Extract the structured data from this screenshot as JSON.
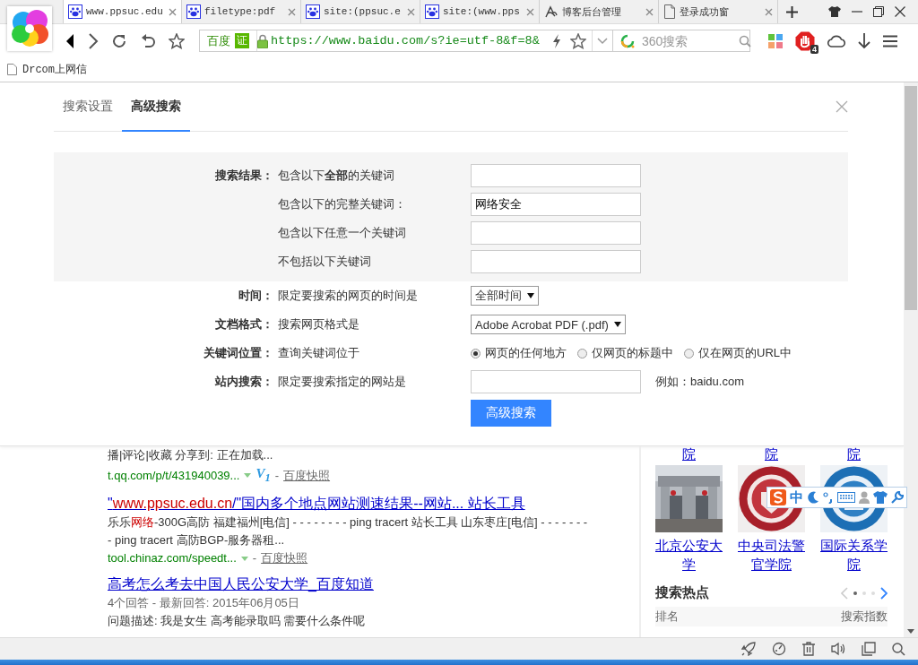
{
  "browser": {
    "tabs": [
      {
        "title": "www.ppsuc.edu",
        "kind": "paw",
        "selected": true
      },
      {
        "title": "filetype:pdf",
        "kind": "paw",
        "selected": false
      },
      {
        "title": "site:(ppsuc.e",
        "kind": "paw",
        "selected": false
      },
      {
        "title": "site:(www.pps",
        "kind": "paw",
        "selected": false
      },
      {
        "title": "博客后台管理",
        "kind": "blog",
        "selected": false
      },
      {
        "title": "登录成功窗",
        "kind": "page",
        "selected": false
      }
    ],
    "address_bar": {
      "site_name": "百度",
      "badge": "证",
      "url": "https://www.baidu.com/s?ie=utf-8&f=8&"
    },
    "search_box": {
      "placeholder": "360搜索"
    },
    "adblock_count": "4",
    "bookmarks": [
      "Drcom上网信"
    ]
  },
  "settings_panel": {
    "tabs": [
      {
        "label": "搜索设置",
        "selected": false
      },
      {
        "label": "高级搜索",
        "selected": true
      }
    ],
    "keyword_group": {
      "label": "搜索结果：",
      "rows": [
        {
          "description": "包含以下**全部**的关键词"
        },
        {
          "description": "包含以下的完整关键词：",
          "value": "网络安全"
        },
        {
          "description": "包含以下任意一个关键词"
        },
        {
          "description": "不包括以下关键词"
        }
      ]
    },
    "rows": [
      {
        "label": "时间：",
        "description": "限定要搜索的网页的时间是",
        "kind": "select",
        "value": "全部时间"
      },
      {
        "label": "文档格式：",
        "description": "搜索网页格式是",
        "kind": "select",
        "value": "Adobe Acrobat PDF (.pdf)"
      },
      {
        "label": "关键词位置：",
        "description": "查询关键词位于",
        "kind": "radio",
        "options": [
          {
            "label": "网页的任何地方",
            "selected": true
          },
          {
            "label": "仅网页的标题中",
            "selected": false
          },
          {
            "label": "仅在网页的URL中",
            "selected": false
          }
        ]
      },
      {
        "label": "站内搜索：",
        "description": "限定要搜索指定的网站是",
        "kind": "text",
        "hint": "例如：baidu.com"
      }
    ],
    "submit": "高级搜索"
  },
  "results": [
    {
      "snippet": [
        {
          "text": "播|评论|收藏 分享到: 正在加载...",
          "highlight": false
        }
      ],
      "url": "t.qq.com/p/t/431940039...",
      "badge": "V$_{1}$",
      "separator": "-",
      "snapshot": "百度快照"
    },
    {
      "title": [
        {
          "text": "\"",
          "highlight": false
        },
        {
          "text": "www.ppsuc.edu.cn",
          "highlight": true
        },
        {
          "text": "/\"国内多个地点网站测速结果--网站...  站长工具",
          "highlight": false
        }
      ],
      "snippet": [
        {
          "text": "乐乐",
          "highlight": false
        },
        {
          "text": "网络",
          "highlight": true
        },
        {
          "text": "-300G高防 福建福州[电信] - - - - - - - - ping tracert 站长工具 山东枣庄[电信] - - - - - - - - ping tracert 高防BGP-服务器租...",
          "highlight": false
        }
      ],
      "url": "tool.chinaz.com/speedt...",
      "separator": "-",
      "snapshot": "百度快照"
    },
    {
      "title": [
        {
          "text": "高考怎么考去中国人民公安大学_百度知道",
          "highlight": false
        }
      ],
      "meta": "4个回答 - 最新回答: 2015年06月05日",
      "description": "问题描述: 我是女生 高考能录取吗 需要什么条件呢"
    }
  ],
  "side_panel": {
    "top_captions": [
      "院",
      "院",
      "院"
    ],
    "cards": [
      {
        "caption": "北京公安大学"
      },
      {
        "caption": "中央司法警官学院"
      },
      {
        "caption": "国际关系学院"
      }
    ],
    "hot": {
      "title": "搜索热点",
      "pages": [
        {
          "selected": true
        },
        {
          "selected": false
        },
        {
          "selected": false
        }
      ],
      "columns": [
        "排名",
        "搜索指数"
      ]
    }
  },
  "ime_toolbar": {
    "mode": "中"
  }
}
